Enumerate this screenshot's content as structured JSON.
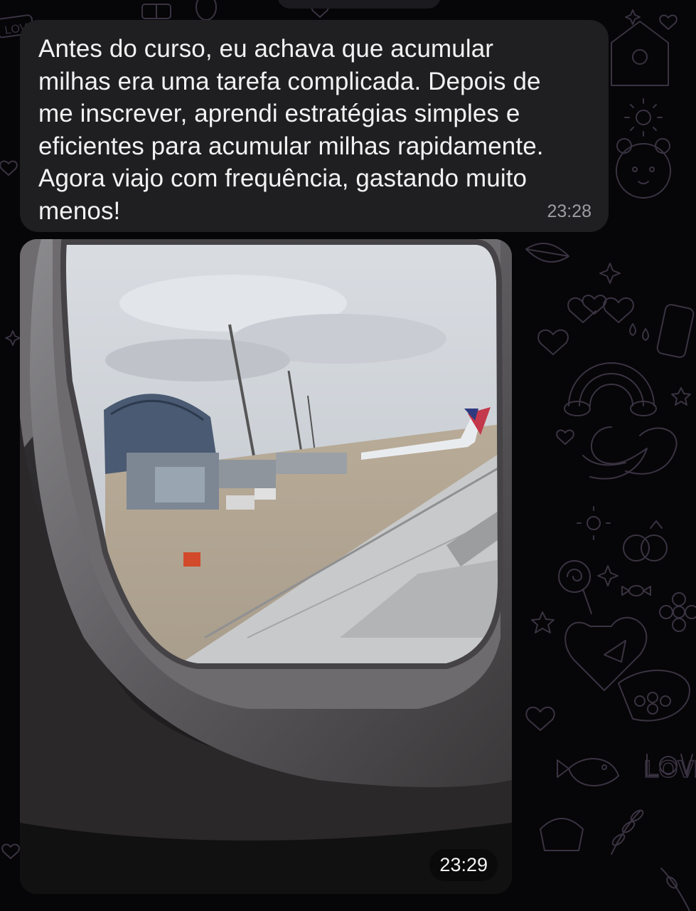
{
  "chat": {
    "messages": [
      {
        "type": "text",
        "text": "Antes do curso, eu achava que acumular\nmilhas era uma tarefa complicada. Depois de\nme inscrever, aprendi estratégias simples e\neficientes para acumular milhas rapidamente.\nAgora viajo com frequência, gastando muito\nmenos!",
        "time": "23:28"
      },
      {
        "type": "photo",
        "time": "23:29"
      }
    ],
    "wallpaper": {
      "background_color": "#060507",
      "doodle_color": "#3a3342",
      "doodle_text": "LOVE",
      "icons": [
        "heart-icon",
        "rainbow-icon",
        "swan-icon",
        "gift-heart-box-icon",
        "lollipop-icon",
        "rings-icon",
        "bear-icon",
        "phone-icon",
        "glasses-icon",
        "sparkle-icon",
        "fish-icon",
        "laurel-icon",
        "candy-icon",
        "sun-icon",
        "flower-icon",
        "star-icon"
      ]
    },
    "colors": {
      "bubble": "#1f1f21",
      "text": "#f2f2f2",
      "timestamp": "#9c9ca2"
    }
  }
}
